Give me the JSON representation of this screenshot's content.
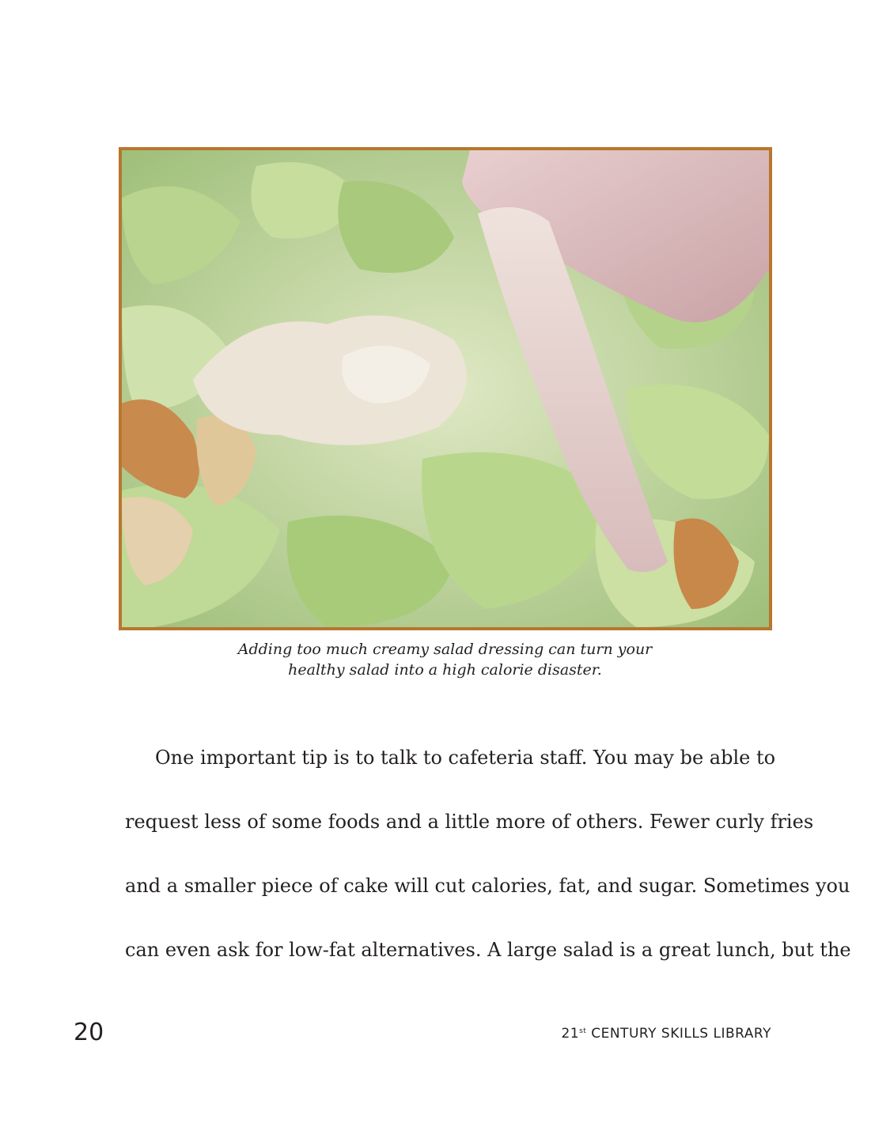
{
  "photo": {
    "frame_color": "#b8762e"
  },
  "caption": {
    "line1": "Adding too much creamy salad dressing can turn your",
    "line2": "healthy salad into a high calorie disaster."
  },
  "body": {
    "lines": [
      "One important tip is to talk to cafeteria staff. You may be able to",
      "request less of some foods and a little more of others. Fewer curly fries",
      "and a smaller piece of cake will cut calories, fat, and sugar. Sometimes you",
      "can even ask for low-fat alternatives. A large salad is a great lunch, but the"
    ]
  },
  "footer": {
    "page_number": "20",
    "series_prefix": "21",
    "series_superscript": "st",
    "series_rest": " CENTURY SKILLS LIBRARY"
  }
}
